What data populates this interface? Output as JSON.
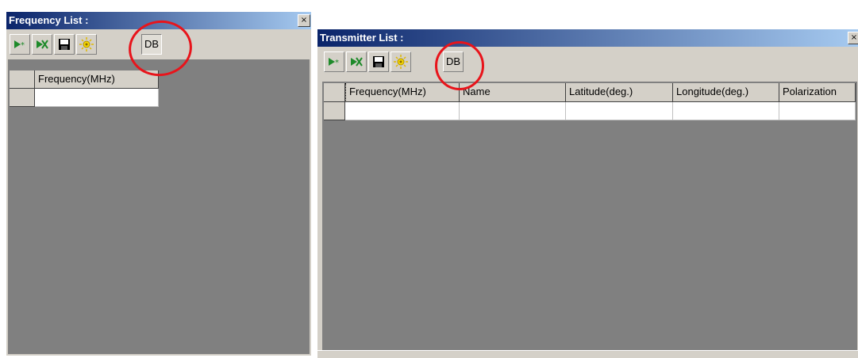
{
  "frequency_panel": {
    "title": "Frequency List :",
    "close_glyph": "×",
    "toolbar": {
      "buttons": [
        {
          "name": "add-row",
          "icon": "add-row-icon"
        },
        {
          "name": "delete-row",
          "icon": "delete-row-icon"
        },
        {
          "name": "save",
          "icon": "save-icon"
        },
        {
          "name": "refresh",
          "icon": "sun-icon"
        },
        {
          "name": "db",
          "label": "DB"
        }
      ]
    },
    "table": {
      "columns": [
        "Frequency(MHz)"
      ],
      "rows": [
        [
          ""
        ]
      ]
    }
  },
  "transmitter_panel": {
    "title": "Transmitter List :",
    "close_glyph": "×",
    "toolbar": {
      "buttons": [
        {
          "name": "add-row",
          "icon": "add-row-icon"
        },
        {
          "name": "delete-row",
          "icon": "delete-row-icon"
        },
        {
          "name": "save",
          "icon": "save-icon"
        },
        {
          "name": "refresh",
          "icon": "sun-icon"
        },
        {
          "name": "db",
          "label": "DB"
        }
      ]
    },
    "table": {
      "columns": [
        "Frequency(MHz)",
        "Name",
        "Latitude(deg.)",
        "Longitude(deg.)",
        "Polarization"
      ],
      "rows": [
        [
          "",
          "",
          "",
          "",
          ""
        ]
      ]
    }
  },
  "colors": {
    "highlight_circle": "#e8141b",
    "title_start": "#0a246a",
    "title_end": "#a6caf0",
    "grid_bg": "#808080"
  }
}
